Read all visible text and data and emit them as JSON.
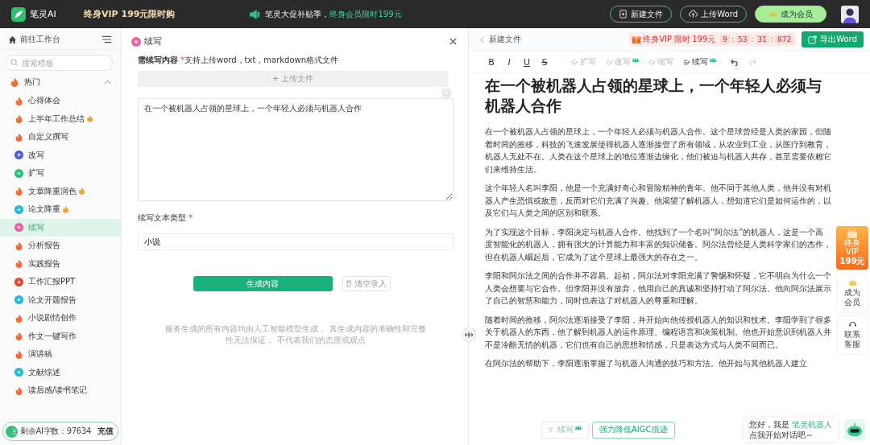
{
  "topbar": {
    "logo": "笔灵AI",
    "promo": "终身VIP 199元限时购",
    "notice": "笔灵大促补贴季，",
    "notice_highlight": "终身会员限时199元",
    "buttons": [
      {
        "label": "新建文件",
        "kind": "file"
      },
      {
        "label": "上传Word",
        "kind": "upload"
      },
      {
        "label": "成为会员",
        "kind": "vip"
      }
    ]
  },
  "sidebar": {
    "home": "前往工作台",
    "search": {
      "placeholder": "搜索模板"
    },
    "group": {
      "label": "热门",
      "expanded": true
    },
    "items": [
      {
        "label": "心得体会",
        "kind": "fire",
        "color": "#f26b3a",
        "hot": false,
        "selected": false
      },
      {
        "label": "上半年工作总结",
        "kind": "fire",
        "color": "#f26b3a",
        "hot": true,
        "selected": false
      },
      {
        "label": "自定义撰写",
        "kind": "fire",
        "color": "#f26b3a",
        "hot": false,
        "selected": false
      },
      {
        "label": "改写",
        "kind": "dot",
        "color": "#4f5bd5",
        "hot": false,
        "selected": false
      },
      {
        "label": "扩写",
        "kind": "dot",
        "color": "#2bbf7e",
        "hot": false,
        "selected": false
      },
      {
        "label": "文章降重润色",
        "kind": "fire",
        "color": "#f26b3a",
        "hot": true,
        "selected": false
      },
      {
        "label": "论文降重",
        "kind": "dot",
        "color": "#22b8d6",
        "hot": true,
        "selected": false
      },
      {
        "label": "续写",
        "kind": "dot",
        "color": "#ec5fa0",
        "hot": false,
        "selected": true
      },
      {
        "label": "分析报告",
        "kind": "fire",
        "color": "#f26b3a",
        "hot": false,
        "selected": false
      },
      {
        "label": "实践报告",
        "kind": "fire",
        "color": "#f26b3a",
        "hot": false,
        "selected": false
      },
      {
        "label": "工作汇报PPT",
        "kind": "dot",
        "color": "#e0452f",
        "hot": false,
        "selected": false
      },
      {
        "label": "论文开题报告",
        "kind": "dot",
        "color": "#22b8d6",
        "hot": false,
        "selected": false
      },
      {
        "label": "小说剧情创作",
        "kind": "fire",
        "color": "#f26b3a",
        "hot": false,
        "selected": false
      },
      {
        "label": "作文一键写作",
        "kind": "fire",
        "color": "#f26b3a",
        "hot": false,
        "selected": false
      },
      {
        "label": "演讲稿",
        "kind": "fire",
        "color": "#f26b3a",
        "hot": false,
        "selected": false
      },
      {
        "label": "文献综述",
        "kind": "dot",
        "color": "#22b8d6",
        "hot": false,
        "selected": false
      },
      {
        "label": "读后感/读书笔记",
        "kind": "fire",
        "color": "#f26b3a",
        "hot": false,
        "selected": false
      }
    ],
    "quota": {
      "label": "剩余AI字数：97634",
      "action": "充值"
    }
  },
  "form": {
    "title": "续写",
    "content_label": "需续写内容",
    "required_mark": "*",
    "content_hint": "支持上传word，txt，markdown格式文件",
    "upload": "+ 上传文件",
    "content_value": "在一个被机器人占领的星球上，一个年轻人必须与机器人合作",
    "type_label": "续写文本类型",
    "type_value": "小说",
    "generate": "生成内容",
    "clear": "清空录入",
    "disclaimer": "服务生成的所有内容均由人工智能模型生成， 其生成内容的准确性和完整性无法保证， 不代表我们的态度或观点"
  },
  "editor": {
    "file_name": "新建文件",
    "vip_offer": {
      "label": "终身VIP 限时",
      "price": "199元"
    },
    "countdown": {
      "parts": [
        "9",
        "53",
        "31",
        "872"
      ],
      "separator": ":"
    },
    "export": "导出Word",
    "formats": [
      "B",
      "I",
      "U",
      "S"
    ],
    "tools": [
      {
        "label": "扩写",
        "disabled": true,
        "crown": false
      },
      {
        "label": "改写",
        "disabled": true,
        "crown": true
      },
      {
        "label": "缩写",
        "disabled": true,
        "crown": false
      },
      {
        "label": "续写",
        "disabled": false,
        "crown": true
      }
    ],
    "undo": {
      "disabled": false
    },
    "redo": {
      "disabled": true
    },
    "title": "在一个被机器人占领的星球上，一个年轻人必须与机器人合作",
    "paragraphs": [
      "在一个被机器人占领的星球上，一个年轻人必须与机器人合作。这个星球曾经是人类的家园，但随着时间的推移，科技的飞速发展使得机器人逐渐接管了所有领域，从农业到工业，从医疗到教育，机器人无处不在。人类在这个星球上的地位逐渐边缘化，他们被迫与机器人共存，甚至需要依赖它们来维持生活。",
      "这个年轻人名叫李阳，他是一个充满好奇心和冒险精神的青年。他不同于其他人类，他并没有对机器人产生恐惧或敌意，反而对它们充满了兴趣。他渴望了解机器人，想知道它们是如何运作的，以及它们与人类之间的区别和联系。",
      "为了实现这个目标，李阳决定与机器人合作。他找到了一个名叫“阿尔法”的机器人，这是一个高度智能化的机器人，拥有强大的计算能力和丰富的知识储备。阿尔法曾经是人类科学家们的杰作，但在机器人崛起后，它成为了这个星球上最强大的存在之一。",
      "李阳和阿尔法之间的合作并不容易。起初，阿尔法对李阳充满了警惕和怀疑，它不明白为什么一个人类会想要与它合作。但李阳并没有放弃，他用自己的真诚和坚持打动了阿尔法。他向阿尔法展示了自己的智慧和能力，同时也表达了对机器人的尊重和理解。",
      "随着时间的推移，阿尔法逐渐接受了李阳，并开始向他传授机器人的知识和技术。李阳学到了很多关于机器人的东西，他了解到机器人的运作原理、编程语言和决策机制。他也开始意识到机器人并不是冷酷无情的机器，它们也有自己的思想和情感，只是表达方式与人类不同而已。",
      "在阿尔法的帮助下，李阳逐渐掌握了与机器人沟通的技巧和方法。他开始与其他机器人建立"
    ],
    "side": {
      "vip": "终身VIP",
      "vip_price": "199元",
      "member": "成为会员",
      "service": "联系客服"
    },
    "chat": {
      "greeting": "您好，我是 ",
      "bot_name": "笔灵机器人",
      "prompt": "点我开始对话吧～"
    },
    "float_tools": [
      {
        "label": "续写",
        "kind": "crown"
      },
      {
        "label": "强力降低AIGC痕迹",
        "kind": "highlight"
      }
    ]
  }
}
